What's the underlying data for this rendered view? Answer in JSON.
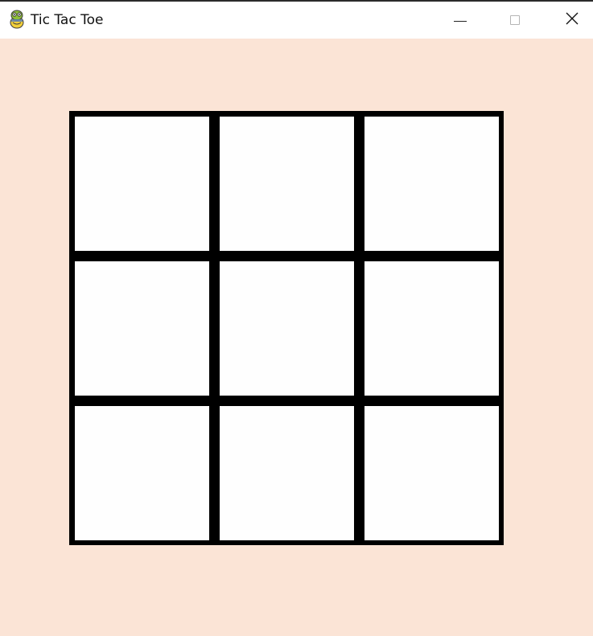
{
  "window": {
    "title": "Tic Tac Toe",
    "app_icon": "python-snake-icon",
    "controls": {
      "minimize_icon": "minimize-icon",
      "maximize_icon": "maximize-icon",
      "close_icon": "close-icon"
    }
  },
  "game": {
    "background_color": "#fbe4d6",
    "grid_line_color": "#000000",
    "cell_color": "#fefefe",
    "board": [
      [
        "",
        "",
        ""
      ],
      [
        "",
        "",
        ""
      ],
      [
        "",
        "",
        ""
      ]
    ]
  }
}
